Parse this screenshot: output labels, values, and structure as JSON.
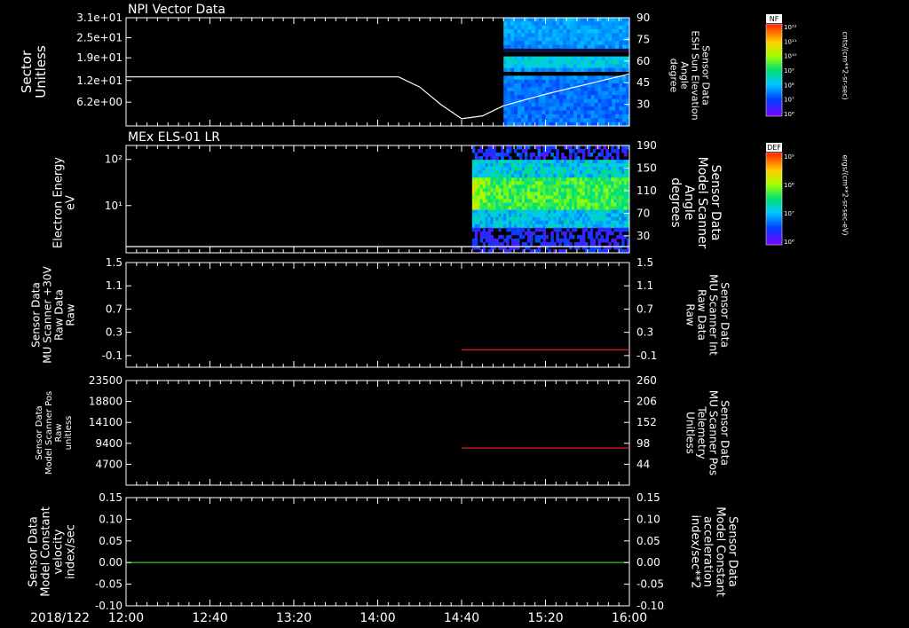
{
  "chart_data": {
    "type": "multi-panel time series",
    "date_label": "2018/122",
    "x_ticks": [
      "12:00",
      "12:40",
      "13:20",
      "14:00",
      "14:40",
      "15:20",
      "16:00"
    ],
    "panels": [
      {
        "title": "NPI Vector Data",
        "type": "spectrogram + line",
        "ylabel_left": [
          "Sector",
          "Unitless"
        ],
        "y_ticks_left": [
          "3.1e+01",
          "2.5e+01",
          "1.9e+01",
          "1.2e+01",
          "6.2e+00"
        ],
        "ylabel_right": [
          "Sensor Data",
          "ESH Sun Elevation",
          "Angle",
          "degree"
        ],
        "y_ticks_right": [
          "90",
          "75",
          "60",
          "45",
          "30"
        ],
        "ylim_right": [
          15,
          90
        ],
        "spectrogram_start": "15:00",
        "colorbar": {
          "title": "NF",
          "ticks": [
            "10¹²",
            "10¹¹",
            "10¹⁰",
            "10⁹",
            "10⁸",
            "10⁷",
            "10⁶"
          ],
          "unit": "cnts/(cm**2-sr-sec)"
        },
        "line_series": {
          "color": "#ffffff",
          "x": [
            "12:00",
            "14:00",
            "14:10",
            "14:20",
            "14:30",
            "14:40",
            "14:50",
            "15:00",
            "15:20",
            "15:40",
            "16:00"
          ],
          "y": [
            49,
            49,
            49,
            42,
            30,
            20,
            22,
            29,
            37,
            44,
            51
          ]
        }
      },
      {
        "title": "MEx ELS-01 LR",
        "type": "spectrogram + line",
        "ylabel_left": [
          "Electron Energy",
          "eV"
        ],
        "y_ticks_left": [
          "10²",
          "10¹"
        ],
        "ylabel_right": [
          "Sensor Data",
          "Model Scanner",
          "Angle",
          "degrees"
        ],
        "y_ticks_right": [
          "190",
          "150",
          "110",
          "70",
          "30"
        ],
        "ylim_right": [
          0,
          190
        ],
        "spectrogram_start": "14:45",
        "colorbar": {
          "title": "DEF",
          "ticks": [
            "10⁹",
            "10⁸",
            "10⁷",
            "10⁶"
          ],
          "unit": "ergs/(cm**2-sr-sec-eV)"
        },
        "line_series": {
          "color": "#ffffff",
          "x": [
            "12:00",
            "16:00"
          ],
          "y": [
            11,
            11
          ]
        }
      },
      {
        "type": "line",
        "ylabel_left": [
          "Sensor Data",
          "MU Scanner +30V",
          "Raw Data",
          "Raw"
        ],
        "y_ticks_left": [
          "1.5",
          "1.1",
          "0.7",
          "0.3",
          "-0.1"
        ],
        "ylabel_right": [
          "Sensor Data",
          "MU Scanner Int",
          "Raw Data",
          "Raw"
        ],
        "y_ticks_right": [
          "1.5",
          "1.1",
          "0.7",
          "0.3",
          "-0.1"
        ],
        "ylim": [
          -0.3,
          1.5
        ],
        "right_label_color": "#ff2020",
        "series": [
          {
            "color": "#ff2020",
            "x": [
              "14:40",
              "16:00"
            ],
            "y": [
              0.0,
              0.0
            ]
          }
        ]
      },
      {
        "type": "line",
        "ylabel_left": [
          "Sensor Data",
          "Model Scanner Pos",
          "Raw",
          "unitless"
        ],
        "y_ticks_left": [
          "23500",
          "18800",
          "14100",
          "9400",
          "4700"
        ],
        "ylabel_right": [
          "Sensor Data",
          "MU Scanner Pos",
          "Telemetry",
          "Unitless"
        ],
        "y_ticks_right": [
          "260",
          "206",
          "152",
          "98",
          "44"
        ],
        "ylim_right": [
          -10,
          260
        ],
        "right_label_color": "#ff2020",
        "series": [
          {
            "color": "#ff2020",
            "x": [
              "14:40",
              "16:00"
            ],
            "y": [
              86,
              86
            ]
          }
        ]
      },
      {
        "type": "line",
        "ylabel_left": [
          "Sensor Data",
          "Model Constant",
          "velocity",
          "index/sec"
        ],
        "y_ticks_left": [
          "0.15",
          "0.10",
          "0.05",
          "0.00",
          "-0.05",
          "-0.10"
        ],
        "ylabel_right": [
          "Sensor Data",
          "Model Constant",
          "acceleration",
          "index/sec**2"
        ],
        "y_ticks_right": [
          "0.15",
          "0.10",
          "0.05",
          "0.00",
          "-0.05",
          "-0.10"
        ],
        "ylim": [
          -0.1,
          0.15
        ],
        "right_label_color": "#20e020",
        "series": [
          {
            "color": "#20e020",
            "x": [
              "12:00",
              "16:00"
            ],
            "y": [
              0.0,
              0.0
            ]
          }
        ]
      }
    ]
  }
}
